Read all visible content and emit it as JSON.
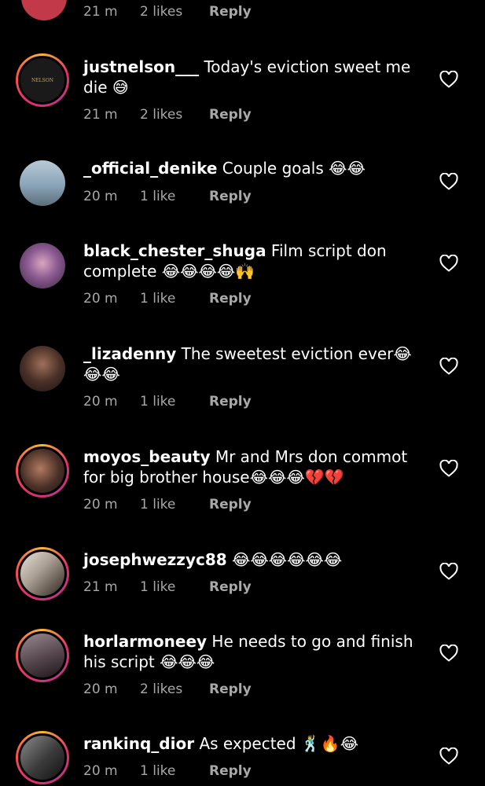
{
  "top_row": {
    "time": "21 m",
    "likes": "2 likes",
    "reply": "Reply"
  },
  "comments": [
    {
      "user": "justnelson___",
      "text": " Today's eviction sweet me die 😅",
      "time": "21 m",
      "likes": "2 likes",
      "reply": "Reply",
      "avatar_label": "NELSON",
      "avatar_color": "#1a1a1a",
      "ring": true
    },
    {
      "user": "_official_denike",
      "text": " Couple goals 😂😂",
      "time": "20 m",
      "likes": "1 like",
      "reply": "Reply",
      "avatar_color": "#8aa4b8",
      "ring": false
    },
    {
      "user": "black_chester_shuga",
      "text": " Film script don complete 😂😂😂😂🙌",
      "time": "20 m",
      "likes": "1 like",
      "reply": "Reply",
      "avatar_color": "#7d5a8a",
      "ring": false
    },
    {
      "user": "_lizadenny",
      "text": " The sweetest eviction ever😂😂😂",
      "time": "20 m",
      "likes": "1 like",
      "reply": "Reply",
      "avatar_color": "#3a2a24",
      "ring": false
    },
    {
      "user": "moyos_beauty",
      "text": " Mr and Mrs don commot for big brother house😂😂😂💔💔",
      "time": "20 m",
      "likes": "1 like",
      "reply": "Reply",
      "avatar_color": "#3b2b25",
      "ring": true
    },
    {
      "user": "josephwezzyc88",
      "text": " 😂😂😂😂😂😂",
      "time": "21 m",
      "likes": "1 like",
      "reply": "Reply",
      "avatar_color": "#c9c2b8",
      "ring": true
    },
    {
      "user": "horlarmoneey",
      "text": " He needs to go and finish his script 😂😂😂",
      "time": "20 m",
      "likes": "2 likes",
      "reply": "Reply",
      "avatar_color": "#6e5f66",
      "ring": true
    },
    {
      "user": "rankinq_dior",
      "text": " As expected 🕺🔥😂",
      "time": "20 m",
      "likes": "1 like",
      "reply": "Reply",
      "avatar_color": "#4a4a4a",
      "ring": true
    }
  ],
  "colors": {
    "background": "#000000",
    "text": "#ffffff",
    "meta": "#a8a8a8"
  }
}
